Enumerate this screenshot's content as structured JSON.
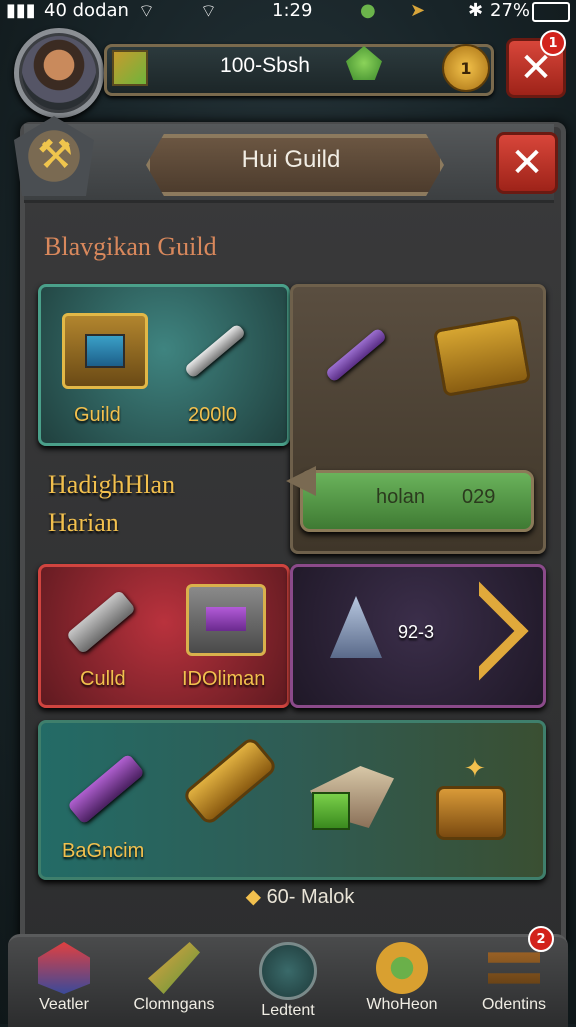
{
  "status_bar": {
    "carrier": "40 dodan",
    "time": "1:29",
    "battery": "27%"
  },
  "top_bar": {
    "resource_value": "100-Sbsh",
    "coin_label": "1",
    "notification_count": "1"
  },
  "panel": {
    "title": "Hui Guild",
    "section_title": "Blavgikan Guild"
  },
  "cards": {
    "card1": {
      "label_left": "Guild",
      "label_right": "200l0"
    },
    "card2": {
      "button_label_left": "holan",
      "button_label_right": "029"
    },
    "card3": {
      "label_left": "Culld",
      "label_right": "IDOliman"
    },
    "card4": {
      "value": "92-3"
    },
    "card5": {
      "label_left": "BaGncim"
    }
  },
  "side_text": {
    "line1": "HadighHlan",
    "line2": "Harian"
  },
  "footer": {
    "text": "60- Malok"
  },
  "nav": {
    "items": [
      {
        "label": "Veatler",
        "icon": "gem-icon"
      },
      {
        "label": "Clomngans",
        "icon": "spear-icon"
      },
      {
        "label": "Ledtent",
        "icon": "guild-icon"
      },
      {
        "label": "WhoHeon",
        "icon": "gear-icon"
      },
      {
        "label": "Odentins",
        "icon": "barricade-icon",
        "badge": "2"
      }
    ]
  },
  "colors": {
    "accent_gold": "#f2c04e",
    "close_red": "#d8463a",
    "section_title": "#d9885c"
  }
}
